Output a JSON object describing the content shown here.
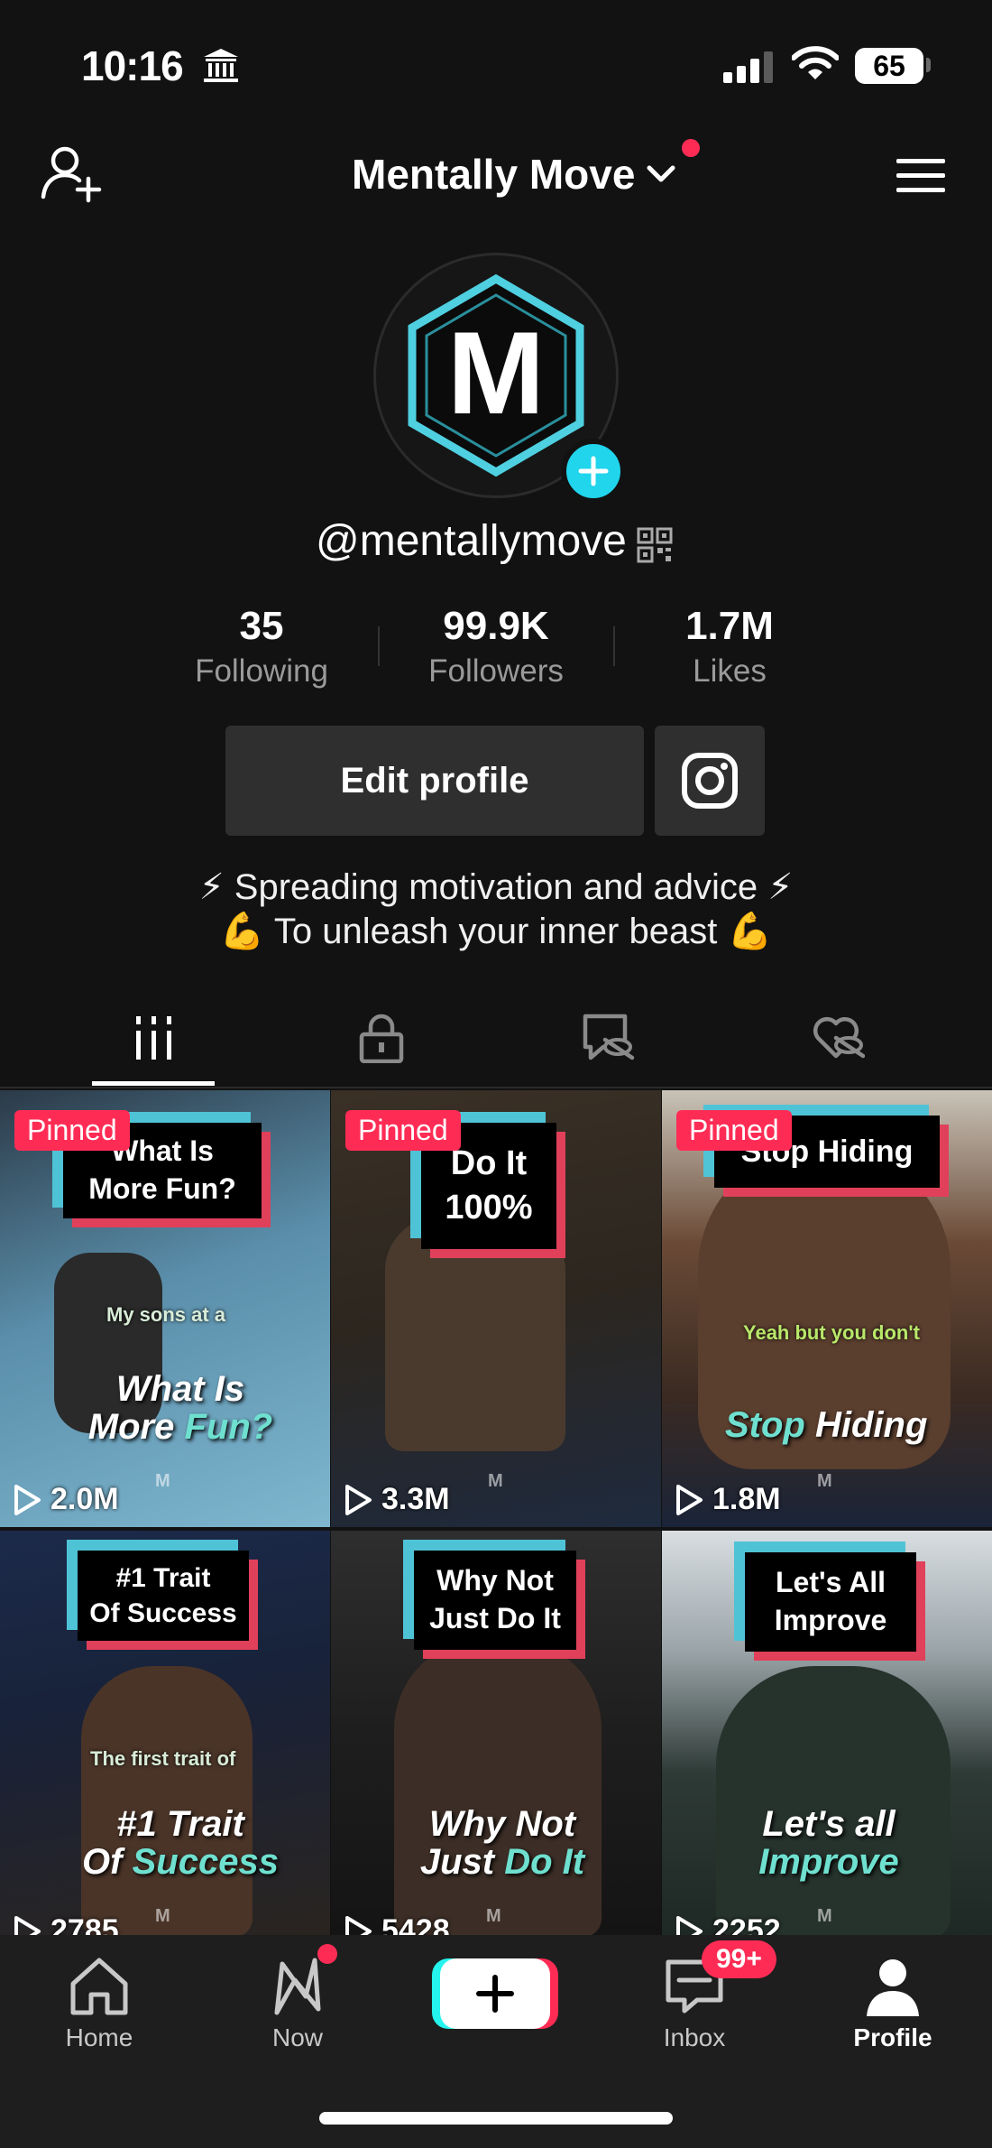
{
  "status_bar": {
    "time": "10:16",
    "battery": "65"
  },
  "header": {
    "title": "Mentally Move"
  },
  "profile": {
    "username": "@mentallymove",
    "avatar_letter": "M",
    "stats": [
      {
        "value": "35",
        "label": "Following"
      },
      {
        "value": "99.9K",
        "label": "Followers"
      },
      {
        "value": "1.7M",
        "label": "Likes"
      }
    ],
    "edit_label": "Edit profile",
    "bio": [
      "⚡ Spreading motivation and advice ⚡",
      "💪 To unleash your inner beast 💪"
    ]
  },
  "tabs": [
    {
      "icon": "videos-grid-icon"
    },
    {
      "icon": "lock-icon"
    },
    {
      "icon": "reposts-hidden-icon"
    },
    {
      "icon": "liked-hidden-icon"
    }
  ],
  "videos": [
    {
      "pinned": "Pinned",
      "card": [
        "What Is",
        "More Fun?"
      ],
      "small_caption": "My sons at a",
      "big_line1": "What Is",
      "big_line2a": "More ",
      "big_line2b": "Fun?",
      "views": "2.0M"
    },
    {
      "pinned": "Pinned",
      "card": [
        "Do It",
        "100%"
      ],
      "small_caption": "",
      "big_line1": "",
      "big_line2a": "",
      "big_line2b": "",
      "views": "3.3M"
    },
    {
      "pinned": "Pinned",
      "card": [
        "Stop Hiding"
      ],
      "small_caption": "Yeah but you don't",
      "big_line1": "",
      "big_line2a": "Stop ",
      "big_line2b": "Hiding",
      "views": "1.8M"
    },
    {
      "pinned": "",
      "card": [
        "#1 Trait",
        "Of Success"
      ],
      "small_caption": "The first trait of",
      "big_line1": "#1 Trait",
      "big_line2a": "Of ",
      "big_line2b": "Success",
      "views": "2785"
    },
    {
      "pinned": "",
      "card": [
        "Why Not",
        "Just Do It"
      ],
      "small_caption": "",
      "big_line1": "Why Not",
      "big_line2a": "Just ",
      "big_line2b": "Do It",
      "views": "5428"
    },
    {
      "pinned": "",
      "card": [
        "Let's All",
        "Improve"
      ],
      "small_caption": "",
      "big_line1": "Let's all",
      "big_line2a": "",
      "big_line2b": "Improve",
      "views": "2252"
    }
  ],
  "watermark": "M",
  "nav": {
    "home": "Home",
    "now": "Now",
    "inbox": "Inbox",
    "inbox_badge": "99+",
    "profile": "Profile"
  },
  "colors": {
    "accent": "#fe2c55",
    "cyan": "#20d5ec",
    "background": "#121212"
  }
}
